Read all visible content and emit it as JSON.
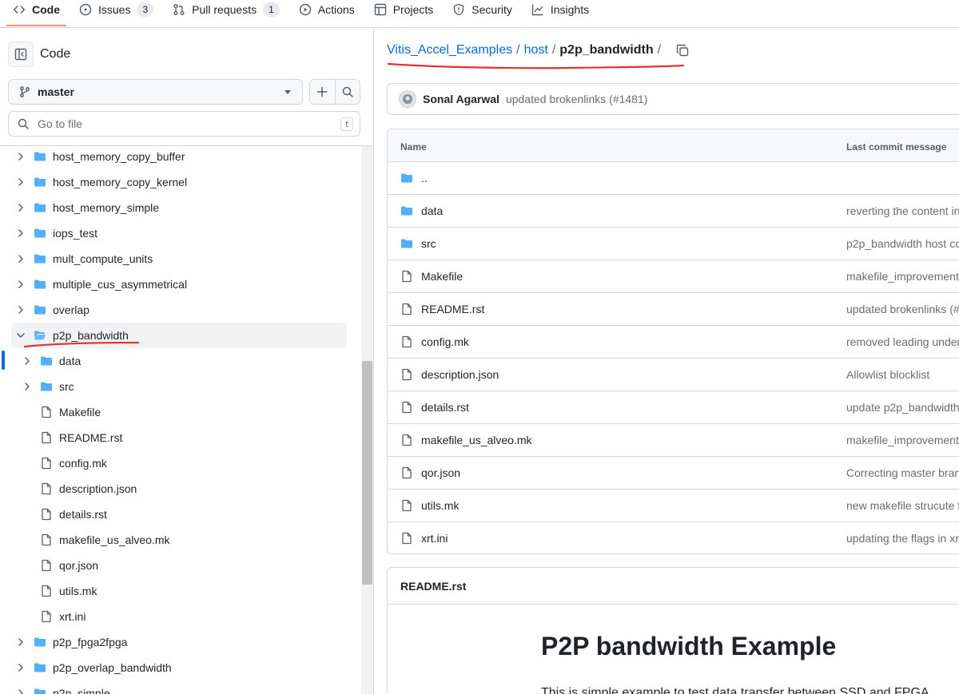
{
  "topnav": {
    "tabs": [
      {
        "label": "Code"
      },
      {
        "label": "Issues",
        "count": "3"
      },
      {
        "label": "Pull requests",
        "count": "1"
      },
      {
        "label": "Actions"
      },
      {
        "label": "Projects"
      },
      {
        "label": "Security"
      },
      {
        "label": "Insights"
      }
    ]
  },
  "sidebar": {
    "title": "Code",
    "branch": "master",
    "goto_placeholder": "Go to file",
    "goto_shortcut": "t",
    "tree": [
      {
        "label": "host_memory_copy_buffer",
        "type": "folder",
        "depth": 0
      },
      {
        "label": "host_memory_copy_kernel",
        "type": "folder",
        "depth": 0
      },
      {
        "label": "host_memory_simple",
        "type": "folder",
        "depth": 0
      },
      {
        "label": "iops_test",
        "type": "folder",
        "depth": 0
      },
      {
        "label": "mult_compute_units",
        "type": "folder",
        "depth": 0
      },
      {
        "label": "multiple_cus_asymmetrical",
        "type": "folder",
        "depth": 0
      },
      {
        "label": "overlap",
        "type": "folder",
        "depth": 0
      },
      {
        "label": "p2p_bandwidth",
        "type": "folder-open",
        "depth": 0,
        "selected": true
      },
      {
        "label": "data",
        "type": "folder",
        "depth": 1
      },
      {
        "label": "src",
        "type": "folder",
        "depth": 1
      },
      {
        "label": "Makefile",
        "type": "file",
        "depth": 1
      },
      {
        "label": "README.rst",
        "type": "file",
        "depth": 1
      },
      {
        "label": "config.mk",
        "type": "file",
        "depth": 1
      },
      {
        "label": "description.json",
        "type": "file",
        "depth": 1
      },
      {
        "label": "details.rst",
        "type": "file",
        "depth": 1
      },
      {
        "label": "makefile_us_alveo.mk",
        "type": "file",
        "depth": 1
      },
      {
        "label": "qor.json",
        "type": "file",
        "depth": 1
      },
      {
        "label": "utils.mk",
        "type": "file",
        "depth": 1
      },
      {
        "label": "xrt.ini",
        "type": "file",
        "depth": 1
      },
      {
        "label": "p2p_fpga2fpga",
        "type": "folder",
        "depth": 0
      },
      {
        "label": "p2p_overlap_bandwidth",
        "type": "folder",
        "depth": 0
      },
      {
        "label": "p2p_simple",
        "type": "folder",
        "depth": 0
      }
    ]
  },
  "breadcrumb": {
    "repo": "Vitis_Accel_Examples",
    "dir": "host",
    "current": "p2p_bandwidth"
  },
  "commit": {
    "author": "Sonal Agarwal",
    "message": "updated brokenlinks (#1481)"
  },
  "files": {
    "header_name": "Name",
    "header_msg": "Last commit message",
    "rows": [
      {
        "name": "..",
        "type": "folder",
        "msg": ""
      },
      {
        "name": "data",
        "type": "folder",
        "msg": "reverting the content in"
      },
      {
        "name": "src",
        "type": "folder",
        "msg": "p2p_bandwidth host co"
      },
      {
        "name": "Makefile",
        "type": "file",
        "msg": "makefile_improvement"
      },
      {
        "name": "README.rst",
        "type": "file",
        "msg": "updated brokenlinks (#"
      },
      {
        "name": "config.mk",
        "type": "file",
        "msg": "removed leading under"
      },
      {
        "name": "description.json",
        "type": "file",
        "msg": "Allowlist blocklist"
      },
      {
        "name": "details.rst",
        "type": "file",
        "msg": "update p2p_bandwidth"
      },
      {
        "name": "makefile_us_alveo.mk",
        "type": "file",
        "msg": "makefile_improvement"
      },
      {
        "name": "qor.json",
        "type": "file",
        "msg": "Correcting master bran"
      },
      {
        "name": "utils.mk",
        "type": "file",
        "msg": "new makefile strucute f"
      },
      {
        "name": "xrt.ini",
        "type": "file",
        "msg": "updating the flags in xr"
      }
    ]
  },
  "readme": {
    "tab": "README.rst",
    "heading": "P2P bandwidth Example",
    "intro": "This is simple example to test data transfer between SSD and FPGA."
  },
  "colors": {
    "accent": "#0969da",
    "folder": "#54aeff",
    "annotation": "#e5322d"
  }
}
